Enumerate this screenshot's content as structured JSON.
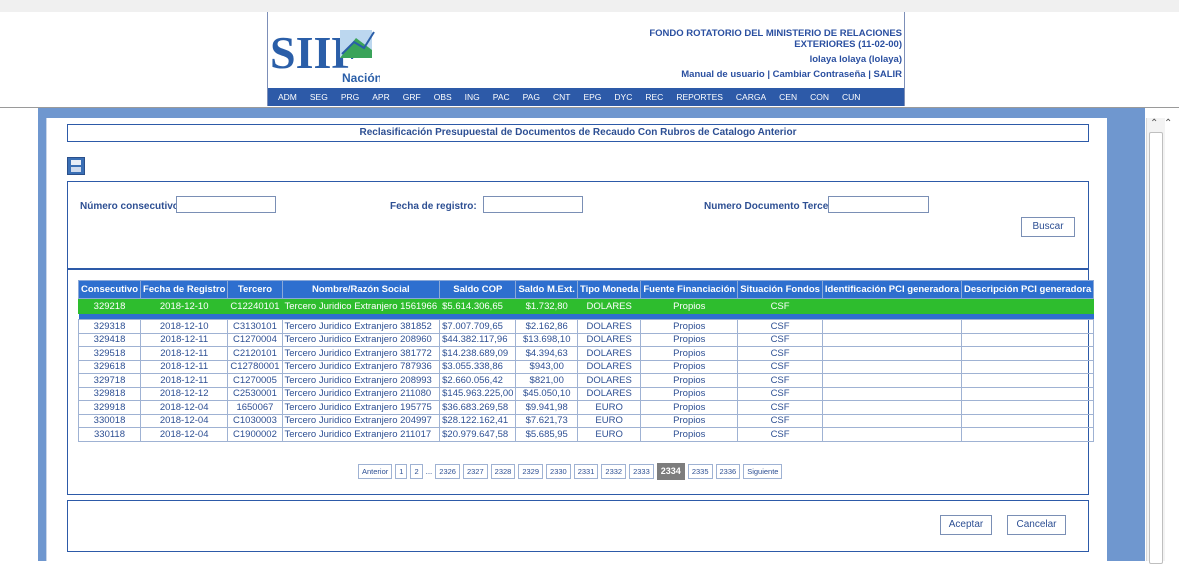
{
  "header": {
    "org_line1": "FONDO ROTATORIO DEL MINISTERIO DE RELACIONES",
    "org_line2": "EXTERIORES (11-02-00)",
    "user": "lolaya lolaya (lolaya)",
    "link_manual": "Manual de usuario",
    "link_password": "Cambiar Contraseña",
    "link_exit": "SALIR",
    "separator": "|",
    "logo_text": "SIIF",
    "logo_sub": "Nación"
  },
  "menu": [
    "ADM",
    "SEG",
    "PRG",
    "APR",
    "GRF",
    "OBS",
    "ING",
    "PAC",
    "PAG",
    "CNT",
    "EPG",
    "DYC",
    "REC",
    "REPORTES",
    "CARGA",
    "CEN",
    "CON",
    "CUN"
  ],
  "page_title": "Reclasificación Presupuestal de Documentos de Recaudo Con Rubros de Catalogo Anterior",
  "search": {
    "consecutivo_label": "Número consecutivo:",
    "consecutivo_value": "",
    "fecha_label": "Fecha de registro:",
    "fecha_value": "",
    "tercero_label": "Numero Documento Tercero:",
    "tercero_value": "",
    "buscar": "Buscar"
  },
  "table": {
    "headers": [
      "Consecutivo",
      "Fecha de Registro",
      "Tercero",
      "Nombre/Razón Social",
      "Saldo COP",
      "Saldo M.Ext.",
      "Tipo Moneda",
      "Fuente Financiación",
      "Situación Fondos",
      "Identificación PCI generadora",
      "Descripción PCI generadora"
    ],
    "selected": [
      "329218",
      "2018-12-10",
      "C12240101",
      "Tercero Juridico Extranjero 1561966",
      "$5.614.306,65",
      "$1.732,80",
      "DOLARES",
      "Propios",
      "CSF",
      "",
      ""
    ],
    "rows": [
      [
        "329318",
        "2018-12-10",
        "C3130101",
        "Tercero Juridico Extranjero 381852",
        "$7.007.709,65",
        "$2.162,86",
        "DOLARES",
        "Propios",
        "CSF",
        "",
        ""
      ],
      [
        "329418",
        "2018-12-11",
        "C1270004",
        "Tercero Juridico Extranjero 208960",
        "$44.382.117,96",
        "$13.698,10",
        "DOLARES",
        "Propios",
        "CSF",
        "",
        ""
      ],
      [
        "329518",
        "2018-12-11",
        "C2120101",
        "Tercero Juridico Extranjero 381772",
        "$14.238.689,09",
        "$4.394,63",
        "DOLARES",
        "Propios",
        "CSF",
        "",
        ""
      ],
      [
        "329618",
        "2018-12-11",
        "C12780001",
        "Tercero Juridico Extranjero 787936",
        "$3.055.338,86",
        "$943,00",
        "DOLARES",
        "Propios",
        "CSF",
        "",
        ""
      ],
      [
        "329718",
        "2018-12-11",
        "C1270005",
        "Tercero Juridico Extranjero 208993",
        "$2.660.056,42",
        "$821,00",
        "DOLARES",
        "Propios",
        "CSF",
        "",
        ""
      ],
      [
        "329818",
        "2018-12-12",
        "C2530001",
        "Tercero Juridico Extranjero 211080",
        "$145.963.225,00",
        "$45.050,10",
        "DOLARES",
        "Propios",
        "CSF",
        "",
        ""
      ],
      [
        "329918",
        "2018-12-04",
        "1650067",
        "Tercero Juridico Extranjero 195775",
        "$36.683.269,58",
        "$9.941,98",
        "EURO",
        "Propios",
        "CSF",
        "",
        ""
      ],
      [
        "330018",
        "2018-12-04",
        "C1030003",
        "Tercero Juridico Extranjero 204997",
        "$28.122.162,41",
        "$7.621,73",
        "EURO",
        "Propios",
        "CSF",
        "",
        ""
      ],
      [
        "330118",
        "2018-12-04",
        "C1900002",
        "Tercero Juridico Extranjero 211017",
        "$20.979.647,58",
        "$5.685,95",
        "EURO",
        "Propios",
        "CSF",
        "",
        ""
      ]
    ]
  },
  "pager": {
    "prev": "Anterior",
    "first_pages": [
      "1",
      "2"
    ],
    "ellipsis": "...",
    "pages": [
      "2326",
      "2327",
      "2328",
      "2329",
      "2330",
      "2331",
      "2332",
      "2333"
    ],
    "current": "2334",
    "after": [
      "2335",
      "2336"
    ],
    "next": "Siguiente"
  },
  "footer": {
    "aceptar": "Aceptar",
    "cancelar": "Cancelar"
  },
  "colors": {
    "accent": "#2e6fcf",
    "selected_row": "#2ebd2e",
    "frame": "#6f97cf"
  }
}
